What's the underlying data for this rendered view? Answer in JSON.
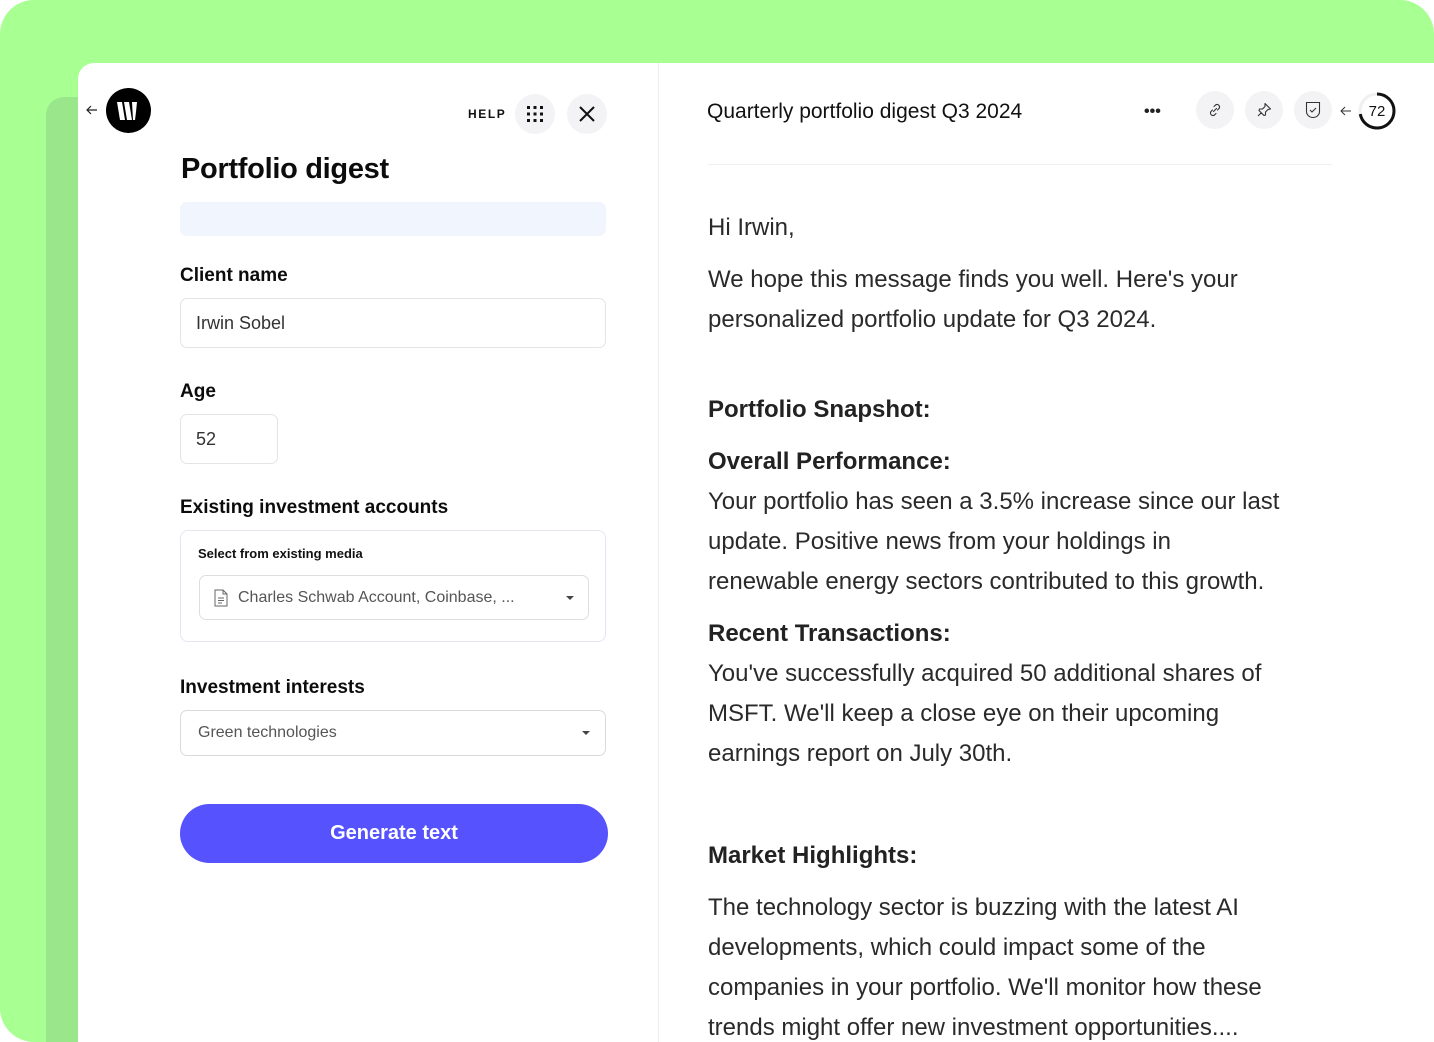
{
  "left": {
    "help_label": "HELP",
    "title": "Portfolio digest",
    "client_name": {
      "label": "Client name",
      "value": "Irwin Sobel"
    },
    "age": {
      "label": "Age",
      "value": "52"
    },
    "accounts": {
      "label": "Existing investment accounts",
      "media_label": "Select from existing media",
      "selected": "Charles Schwab Account, Coinbase, ..."
    },
    "interests": {
      "label": "Investment interests",
      "selected": "Green technologies"
    },
    "generate_label": "Generate text"
  },
  "right": {
    "doc_title": "Quarterly portfolio digest Q3 2024",
    "more_label": "•••",
    "score": {
      "value": "72",
      "fraction": 0.72
    },
    "greeting": "Hi Irwin,",
    "intro_lines": [
      "We hope this message finds you well. Here's your",
      "personalized portfolio update for Q3 2024."
    ],
    "snapshot_heading": "Portfolio Snapshot:",
    "performance_heading": "Overall Performance:",
    "performance_lines": [
      "Your portfolio has seen a 3.5% increase since our last",
      "update. Positive news from your holdings in",
      "renewable energy sectors contributed to this growth."
    ],
    "transactions_heading": "Recent Transactions:",
    "transactions_lines": [
      "You've successfully acquired 50 additional shares of",
      "MSFT. We'll keep a close eye on their upcoming",
      "earnings report on July 30th."
    ],
    "market_heading": "Market Highlights:",
    "market_lines": [
      "The technology sector is buzzing with the latest AI",
      "developments, which could impact some of the",
      "companies in your portfolio. We'll monitor how these",
      "trends might offer new investment opportunities...."
    ]
  },
  "colors": {
    "background_green": "#a8ff92",
    "accent": "#5552fe"
  }
}
